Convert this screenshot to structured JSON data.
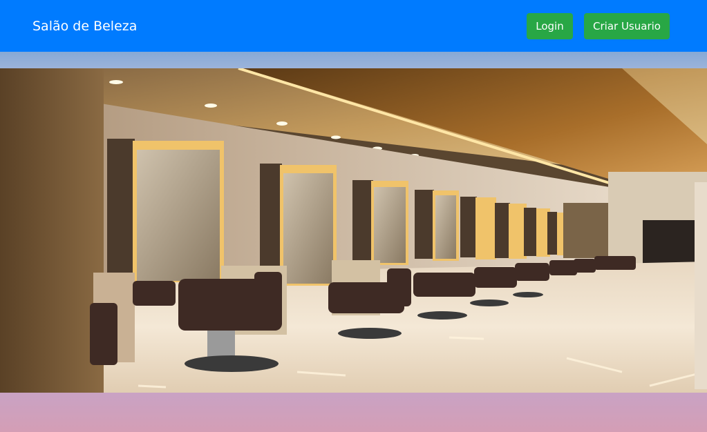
{
  "navbar": {
    "brand": "Salão de Beleza",
    "login_label": "Login",
    "register_label": "Criar Usuario",
    "bg_color": "#007bff",
    "button_color": "#28a745"
  },
  "hero": {
    "image": "salon-interior-photo"
  }
}
